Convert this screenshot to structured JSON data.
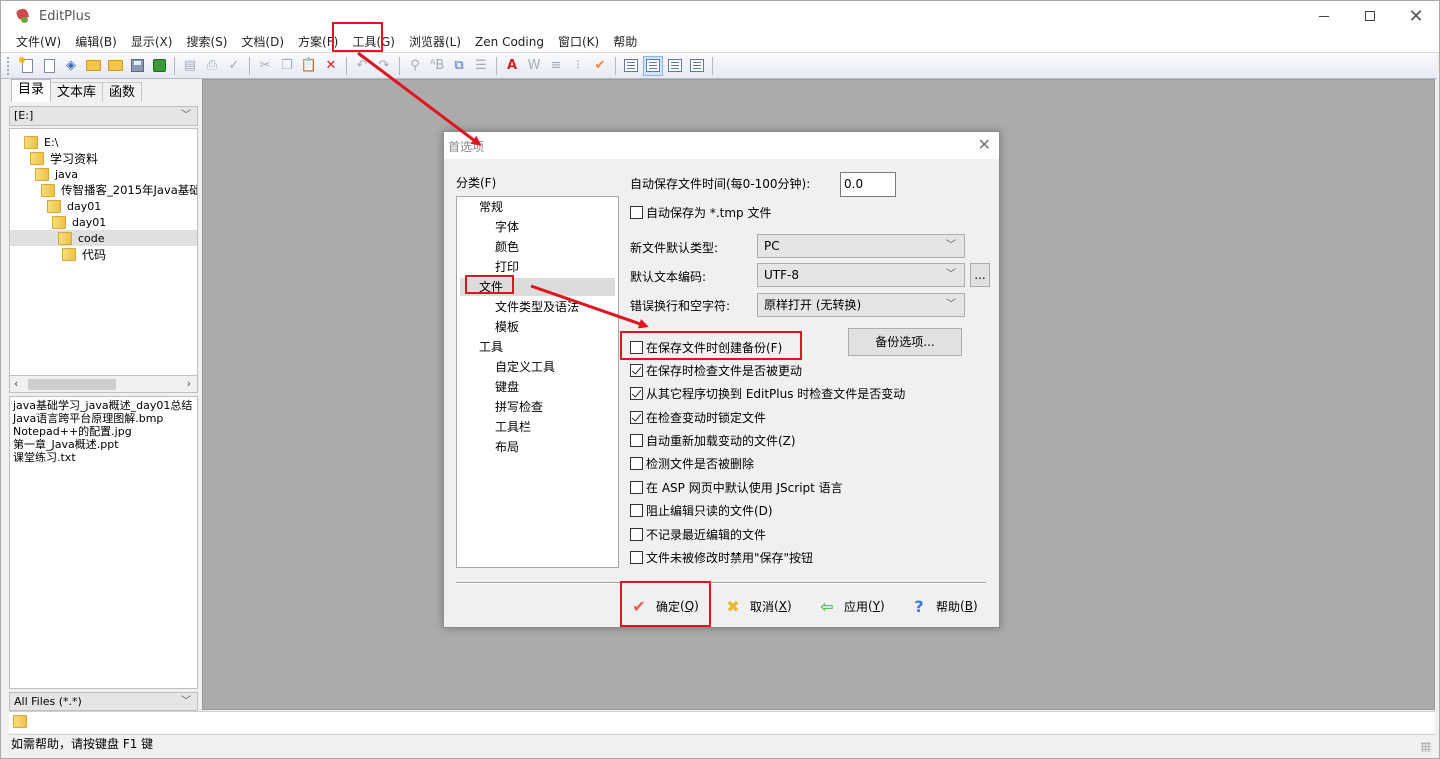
{
  "window": {
    "title": "EditPlus",
    "controls": [
      "minimize-icon",
      "maximize-icon",
      "close-icon"
    ]
  },
  "menu": {
    "items": [
      "文件(W)",
      "编辑(B)",
      "显示(X)",
      "搜索(S)",
      "文档(D)",
      "方案(F)",
      "工具(G)",
      "浏览器(L)",
      "Zen Coding",
      "窗口(K)",
      "帮助"
    ]
  },
  "toolbar": {
    "icons": [
      "new-file-icon",
      "blank-doc-icon",
      "html-doc-icon",
      "open-folder-icon",
      "open-multiple-icon",
      "save-icon",
      "save-all-icon",
      "print-preview-icon",
      "print-icon",
      "spellcheck-icon",
      "cut-icon",
      "copy-icon",
      "paste-icon",
      "delete-icon",
      "undo-icon",
      "redo-icon",
      "find-icon",
      "replace-icon",
      "find-in-files-icon",
      "line-number-icon",
      "font-icon",
      "word-wrap-icon",
      "indent-icon",
      "column-select-icon",
      "check-icon",
      "directory-window-icon",
      "cliptext-window-icon",
      "output-window-icon",
      "fullscreen-icon"
    ]
  },
  "left_panel": {
    "tabs": [
      "目录",
      "文本库",
      "函数"
    ],
    "active_tab": "目录",
    "drive": "[E:]",
    "tree": [
      {
        "label": "E:\\",
        "depth": 0
      },
      {
        "label": "学习资料",
        "depth": 1
      },
      {
        "label": "java",
        "depth": 2
      },
      {
        "label": "传智播客_2015年Java基础",
        "depth": 3
      },
      {
        "label": "day01",
        "depth": 4
      },
      {
        "label": "day01",
        "depth": 5
      },
      {
        "label": "code",
        "depth": 6,
        "selected": true
      },
      {
        "label": "代码",
        "depth": 7
      }
    ],
    "files": [
      "java基础学习_java概述_day01总结",
      "Java语言跨平台原理图解.bmp",
      "Notepad++的配置.jpg",
      "第一章_Java概述.ppt",
      "课堂练习.txt"
    ],
    "filter": "All Files (*.*)"
  },
  "statusbar": {
    "text": "如需帮助，请按键盘 F1 键"
  },
  "dialog": {
    "title": "首选项",
    "category_label": "分类(F)",
    "categories": [
      {
        "label": "常规",
        "level": 0
      },
      {
        "label": "字体",
        "level": 1
      },
      {
        "label": "颜色",
        "level": 1
      },
      {
        "label": "打印",
        "level": 1
      },
      {
        "label": "文件",
        "level": 0,
        "selected": true
      },
      {
        "label": "文件类型及语法",
        "level": 1
      },
      {
        "label": "模板",
        "level": 1
      },
      {
        "label": "工具",
        "level": 0
      },
      {
        "label": "自定义工具",
        "level": 1
      },
      {
        "label": "键盘",
        "level": 1
      },
      {
        "label": "拼写检查",
        "level": 1
      },
      {
        "label": "工具栏",
        "level": 1
      },
      {
        "label": "布局",
        "level": 1
      }
    ],
    "autosave_label": "自动保存文件时间(每0-100分钟):",
    "autosave_value": "0.0",
    "autosave_tmp": {
      "label": "自动保存为 *.tmp 文件",
      "checked": false
    },
    "new_file_type_label": "新文件默认类型:",
    "new_file_type_value": "PC",
    "encoding_label": "默认文本编码:",
    "encoding_value": "UTF-8",
    "encoding_more": "...",
    "linebreak_label": "错误换行和空字符:",
    "linebreak_value": "原样打开 (无转换)",
    "backup_options_button": "备份选项...",
    "checkboxes": [
      {
        "label": "在保存文件时创建备份(F)",
        "checked": false
      },
      {
        "label": "在保存时检查文件是否被更动",
        "checked": true
      },
      {
        "label": "从其它程序切换到 EditPlus 时检查文件是否变动",
        "checked": true
      },
      {
        "label": "在检查变动时锁定文件",
        "checked": true
      },
      {
        "label": "自动重新加载变动的文件(Z)",
        "checked": false
      },
      {
        "label": "检测文件是否被删除",
        "checked": false
      },
      {
        "label": "在 ASP 网页中默认使用 JScript 语言",
        "checked": false
      },
      {
        "label": "阻止编辑只读的文件(D)",
        "checked": false
      },
      {
        "label": "不记录最近编辑的文件",
        "checked": false
      },
      {
        "label": "文件未被修改时禁用\"保存\"按钮",
        "checked": false
      }
    ],
    "buttons": {
      "ok": {
        "label": "确定",
        "key": "Q"
      },
      "cancel": {
        "label": "取消",
        "key": "X"
      },
      "apply": {
        "label": "应用",
        "key": "Y"
      },
      "help": {
        "label": "帮助",
        "key": "B"
      }
    }
  },
  "annotations": {
    "color": "#e0141e",
    "highlighted": [
      "工具(G)",
      "文件",
      "在保存文件时创建备份(F)",
      "确定(Q)"
    ]
  }
}
